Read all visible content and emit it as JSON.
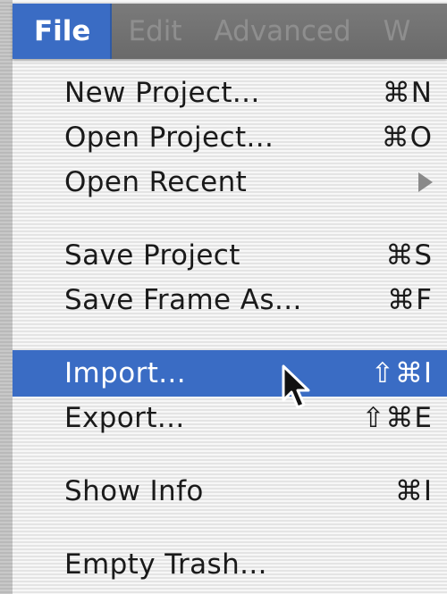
{
  "menubar": {
    "items": [
      {
        "label": "File"
      },
      {
        "label": "Edit"
      },
      {
        "label": "Advanced"
      },
      {
        "label": "W"
      }
    ]
  },
  "menu": {
    "items": [
      {
        "label": "New Project...",
        "shortcut": "⌘N"
      },
      {
        "label": "Open Project...",
        "shortcut": "⌘O"
      },
      {
        "label": "Open Recent",
        "shortcut": ""
      },
      {
        "label": "Save Project",
        "shortcut": "⌘S"
      },
      {
        "label": "Save Frame As...",
        "shortcut": "⌘F"
      },
      {
        "label": "Import...",
        "shortcut": "⇧⌘I"
      },
      {
        "label": "Export...",
        "shortcut": "⇧⌘E"
      },
      {
        "label": "Show Info",
        "shortcut": "⌘I"
      },
      {
        "label": "Empty Trash...",
        "shortcut": ""
      }
    ],
    "highlighted_label": "Import..."
  },
  "colors": {
    "highlight": "#3a6cc4",
    "menubar": "#6f6f6f",
    "text": "#1a1a1a"
  }
}
